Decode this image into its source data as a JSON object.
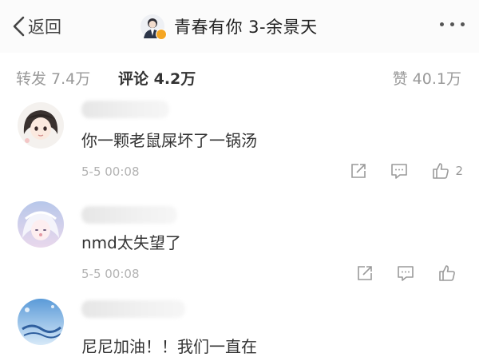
{
  "header": {
    "back_label": "返回",
    "title": "青春有你 3-余景天"
  },
  "tabs": {
    "repost": "转发 7.4万",
    "comment": "评论 4.2万",
    "like": "赞 40.1万"
  },
  "comments": [
    {
      "text": "你一颗老鼠屎坏了一锅汤",
      "time": "5-5 00:08",
      "likes": "2"
    },
    {
      "text": "nmd太失望了",
      "time": "5-5 00:08",
      "likes": ""
    },
    {
      "text": "尼尼加油！！我们一直在"
    }
  ],
  "colors": {
    "accent_verified": "#f5a623",
    "muted": "#999999",
    "time": "#b3b3b3"
  },
  "icons": [
    "chevron-left-icon",
    "more-icon",
    "share-icon",
    "comment-icon",
    "thumb-up-icon"
  ]
}
